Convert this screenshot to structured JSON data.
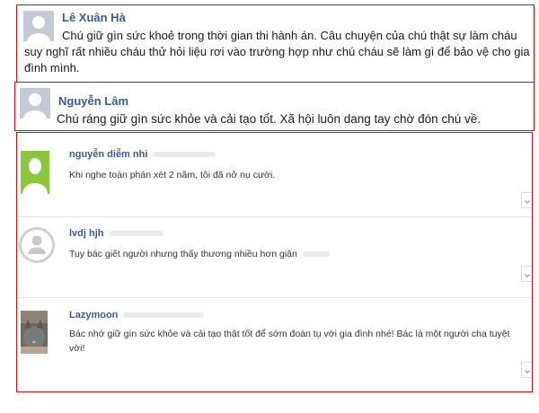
{
  "comments": [
    {
      "name": "Lê Xuân Hà",
      "text": "Chú giữ gìn sức khoẻ trong thời gian thi hành án. Câu chuyện của chú thật sự làm cháu suy nghĩ rất nhiều cháu thử hỏi liệu rơi vào trường hợp như chú cháu sẽ làm gì để bảo vệ cho gia đình mình."
    },
    {
      "name": "Nguyễn Lâm",
      "text": "Chú ráng giữ gìn sức khỏe và cải tạo tốt. Xã hội luôn dang tay chờ đón chú về."
    }
  ],
  "widget_comments": [
    {
      "name": "nguyễn diễm nhi",
      "text": "Khi nghe toàn phán xét 2 năm, tôi đã nở nụ cười.",
      "avatar_icon": "green-silhouette-avatar-icon",
      "avatar_color": "#8cc63f"
    },
    {
      "name": "lvdj hjh",
      "text": "Tuy bác giết người nhưng thấy thương nhiều hơn giận",
      "avatar_icon": "default-person-avatar-icon",
      "avatar_color": "#c8c8c8"
    },
    {
      "name": "Lazymoon",
      "text": "Bác nhớ giữ gìn sức khỏe và cải tạo thật tốt để sớm đoàn tụ với gia đình nhé! Bác là một người cha tuyệt vời!",
      "avatar_icon": "cat-photo-avatar-icon",
      "avatar_color": "#5d5a55"
    }
  ],
  "colors": {
    "highlight_border": "#c4161c",
    "name_link": "#3b5998",
    "placeholder_avatar": "#c3cad6"
  }
}
